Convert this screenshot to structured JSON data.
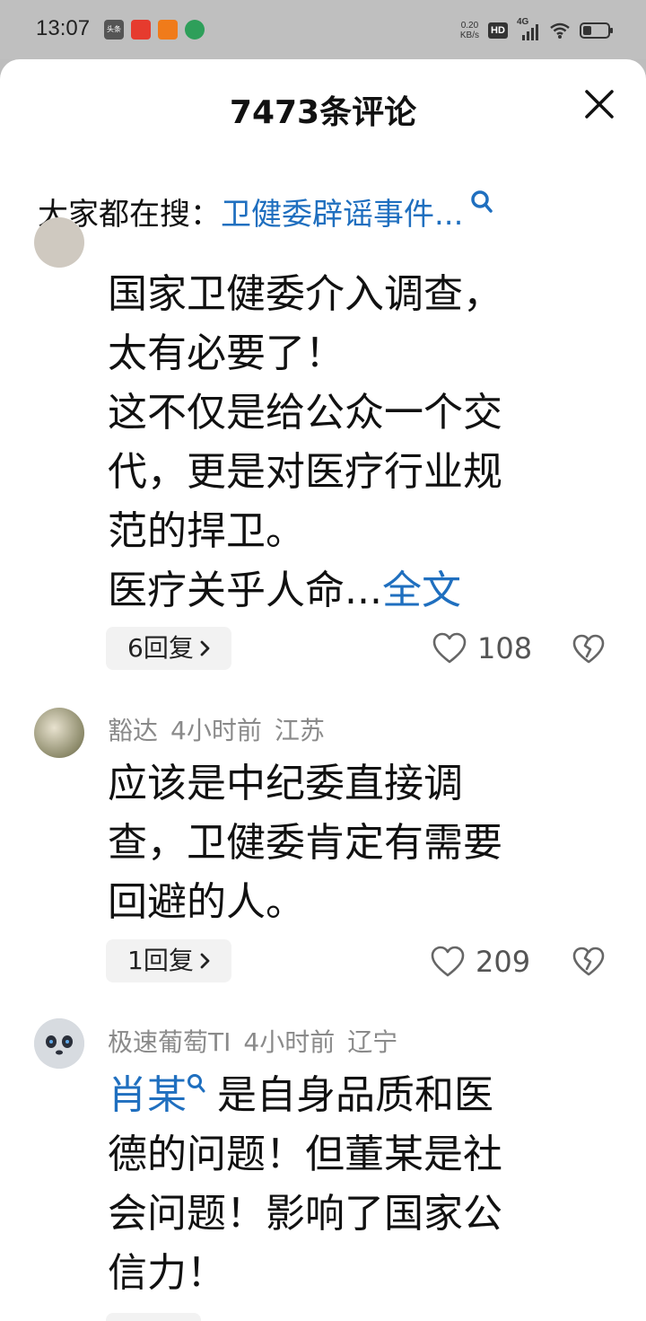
{
  "statusbar": {
    "time": "13:07",
    "notif_1": "头条",
    "net_speed_value": "0.20",
    "net_speed_unit": "KB/s",
    "hd": "HD",
    "signal": "4G",
    "battery_level": 0.35
  },
  "sheet": {
    "title": "7473条评论",
    "search_prefix": "大家都在搜：",
    "search_term": "卫健委辟谣事件..."
  },
  "comments": [
    {
      "lines": [
        "国家卫健委介入调查，",
        "太有必要了！",
        "这不仅是给公众一个交",
        "代，更是对医疗行业规",
        "范的捍卫。"
      ],
      "last_line": "医疗关乎人命...",
      "more": "全文",
      "replies": "6回复",
      "likes": "108"
    },
    {
      "user": "豁达",
      "time": "4小时前",
      "location": "江苏",
      "lines": [
        "应该是中纪委直接调",
        "查，卫健委肯定有需要",
        "回避的人。"
      ],
      "replies": "1回复",
      "likes": "209"
    },
    {
      "user": "极速葡萄TI",
      "time": "4小时前",
      "location": "辽宁",
      "topic": "肖某",
      "first_line_rest": "是自身品质和医",
      "lines": [
        "德的问题！但董某是社",
        "会问题！影响了国家公",
        "信力！"
      ]
    }
  ],
  "colors": {
    "link": "#1f6fbf",
    "meta": "#8a8a8a",
    "chip_bg": "#f2f2f2"
  },
  "icons": [
    "close-icon",
    "search-icon",
    "heart-icon",
    "broken-heart-icon",
    "chevron-right-icon"
  ]
}
